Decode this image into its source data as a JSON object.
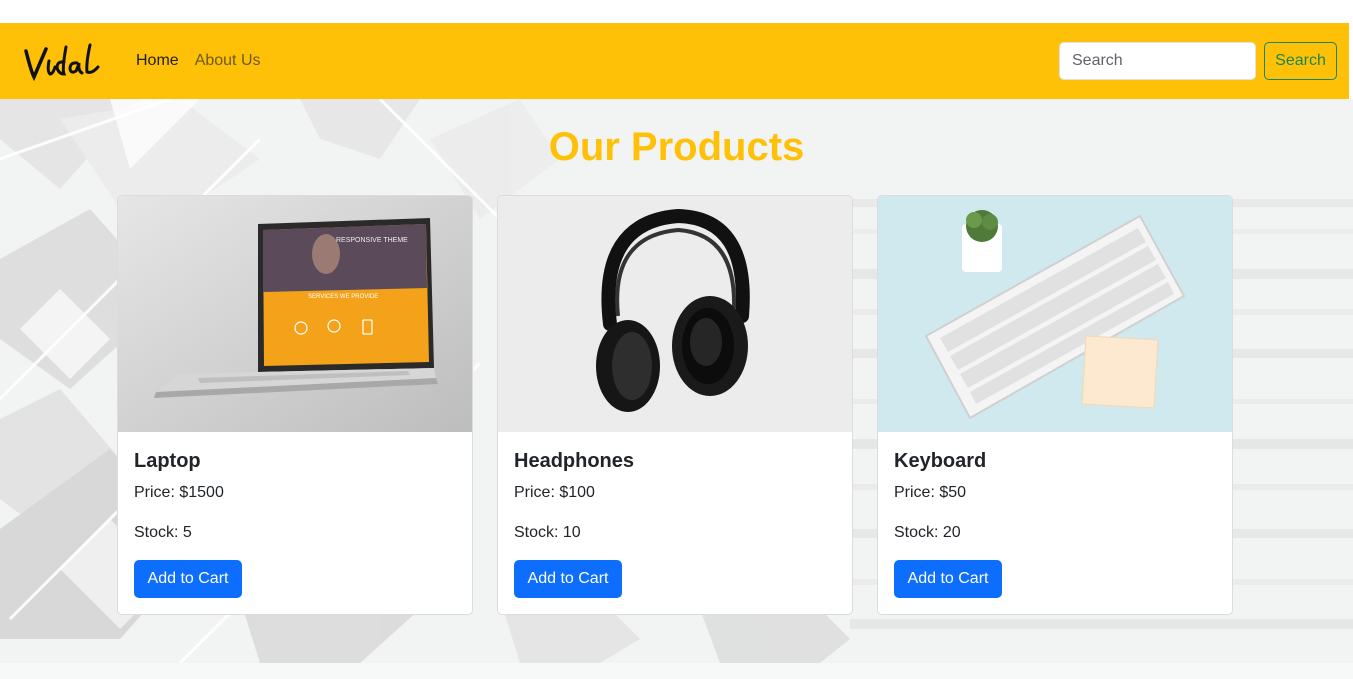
{
  "nav": {
    "logo_text": "Vidal",
    "links": [
      {
        "label": "Home"
      },
      {
        "label": "About Us"
      }
    ],
    "search": {
      "placeholder": "Search",
      "value": ""
    },
    "search_button_label": "Search"
  },
  "main": {
    "title": "Our Products",
    "products": [
      {
        "name": "Laptop",
        "price": "Price: $1500",
        "stock": "Stock: 5",
        "button": "Add to Cart",
        "image_icon": "laptop-image"
      },
      {
        "name": "Headphones",
        "price": "Price: $100",
        "stock": "Stock: 10",
        "button": "Add to Cart",
        "image_icon": "headphones-image"
      },
      {
        "name": "Keyboard",
        "price": "Price: $50",
        "stock": "Stock: 20",
        "button": "Add to Cart",
        "image_icon": "keyboard-image"
      }
    ],
    "laptop_screen_text": {
      "heading": "RESPONSIVE THEME",
      "section": "SERVICES WE PROVIDE"
    }
  },
  "colors": {
    "navbar": "#ffc107",
    "title": "#ffc107",
    "primary_button": "#0d6efd",
    "search_button": "#198754"
  }
}
